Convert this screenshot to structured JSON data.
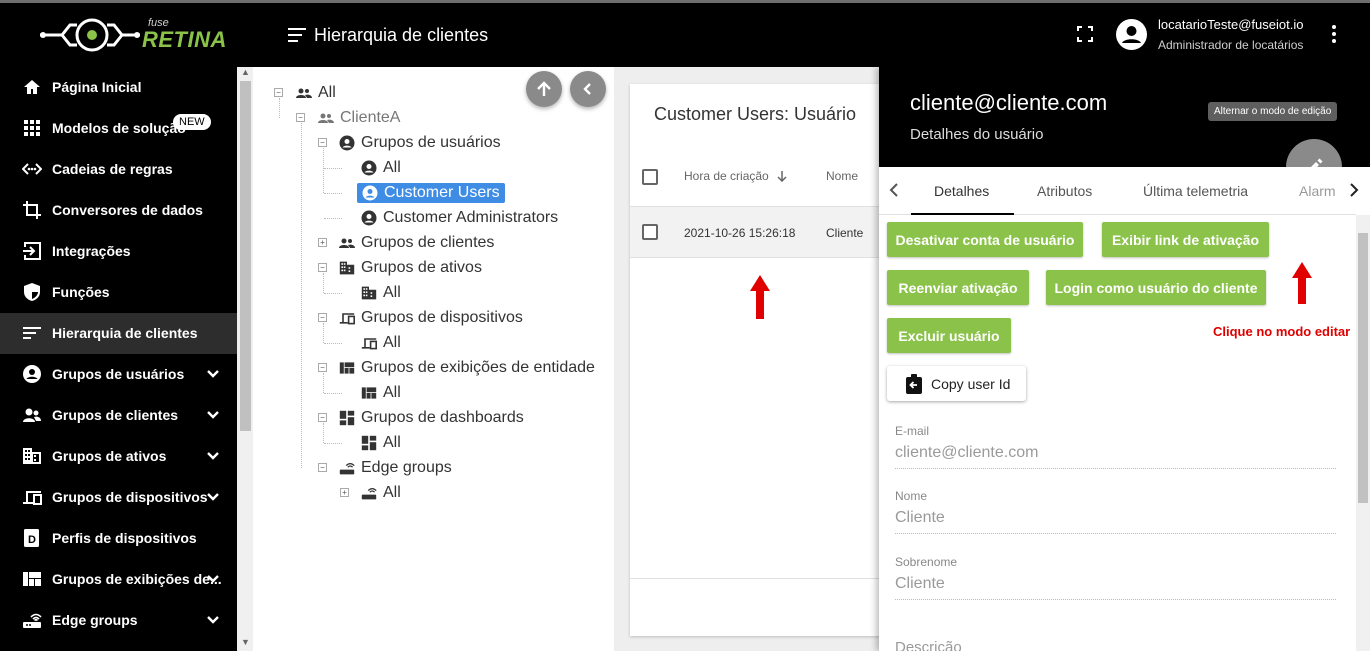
{
  "brand": {
    "fuse": "fuse",
    "retina": "RETINA"
  },
  "header": {
    "title": "Hierarquia de clientes",
    "user_email": "locatarioTeste@fuseiot.io",
    "user_role": "Administrador de locatários"
  },
  "sidebar": {
    "items": [
      {
        "label": "Página Inicial",
        "icon": "home-icon"
      },
      {
        "label": "Modelos de solução",
        "icon": "apps-icon",
        "badge": "NEW"
      },
      {
        "label": "Cadeias de regras",
        "icon": "settings-ethernet-icon"
      },
      {
        "label": "Conversores de dados",
        "icon": "transform-icon"
      },
      {
        "label": "Integrações",
        "icon": "input-icon"
      },
      {
        "label": "Funções",
        "icon": "security-icon"
      },
      {
        "label": "Hierarquia de clientes",
        "icon": "sort-icon",
        "active": true
      },
      {
        "label": "Grupos de usuários",
        "icon": "account-circle-icon"
      },
      {
        "label": "Grupos de clientes",
        "icon": "supervisor-icon"
      },
      {
        "label": "Grupos de ativos",
        "icon": "domain-icon"
      },
      {
        "label": "Grupos de dispositivos",
        "icon": "devices-icon"
      },
      {
        "label": "Perfis de dispositivos",
        "icon": "device-profile-icon"
      },
      {
        "label": "Grupos de exibições de...",
        "icon": "view-quilt-icon"
      },
      {
        "label": "Edge groups",
        "icon": "router-icon"
      }
    ]
  },
  "tree": {
    "root": "All",
    "customer": "ClienteA",
    "user_groups": "Grupos de usuários",
    "user_all": "All",
    "customer_users": "Customer Users",
    "customer_admins": "Customer Administrators",
    "customer_groups": "Grupos de clientes",
    "asset_groups": "Grupos de ativos",
    "asset_all": "All",
    "device_groups": "Grupos de dispositivos",
    "device_all": "All",
    "entity_view_groups": "Grupos de exibições de entidade",
    "entity_view_all": "All",
    "dashboard_groups": "Grupos de dashboards",
    "dashboard_all": "All",
    "edge_groups": "Edge groups",
    "edge_all": "All"
  },
  "table": {
    "title": "Customer Users: Usuário",
    "col_created": "Hora de criação",
    "col_name": "Nome",
    "rows": [
      {
        "created": "2021-10-26 15:26:18",
        "name": "Cliente"
      }
    ]
  },
  "drawer": {
    "email": "cliente@cliente.com",
    "subtitle": "Detalhes do usuário",
    "tooltip": "Alternar o modo de edição",
    "tabs": [
      "Detalhes",
      "Atributos",
      "Última telemetria",
      "Alarm"
    ],
    "buttons": {
      "disable": "Desativar conta de usuário",
      "show_link": "Exibir link de ativação",
      "resend": "Reenviar ativação",
      "login_as": "Login como usuário do cliente",
      "delete": "Excluir usuário",
      "copy_id": "Copy user Id"
    },
    "fields": {
      "email_label": "E-mail",
      "email_value": "cliente@cliente.com",
      "first_name_label": "Nome",
      "first_name_value": "Cliente",
      "last_name_label": "Sobrenome",
      "last_name_value": "Cliente",
      "description_label": "Descrição"
    }
  },
  "annotation": "Clique no modo editar",
  "colors": {
    "accent_green": "#8bc34a",
    "selected_blue": "#3f8ce5",
    "annotation_red": "#e00000"
  }
}
